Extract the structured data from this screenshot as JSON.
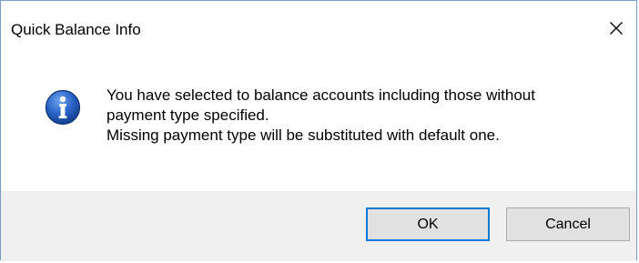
{
  "window": {
    "title": "Quick Balance Info",
    "close_icon": "close-icon"
  },
  "content": {
    "icon": "info-icon",
    "message_lines": [
      "You have selected to balance accounts including those without",
      "payment type specified.",
      "Missing payment type will be substituted with default one."
    ]
  },
  "buttons": {
    "ok_label": "OK",
    "cancel_label": "Cancel"
  },
  "colors": {
    "icon_blue": "#1f5fbf",
    "default_button_border": "#0078d7",
    "footer_background": "#f0f0f0"
  }
}
